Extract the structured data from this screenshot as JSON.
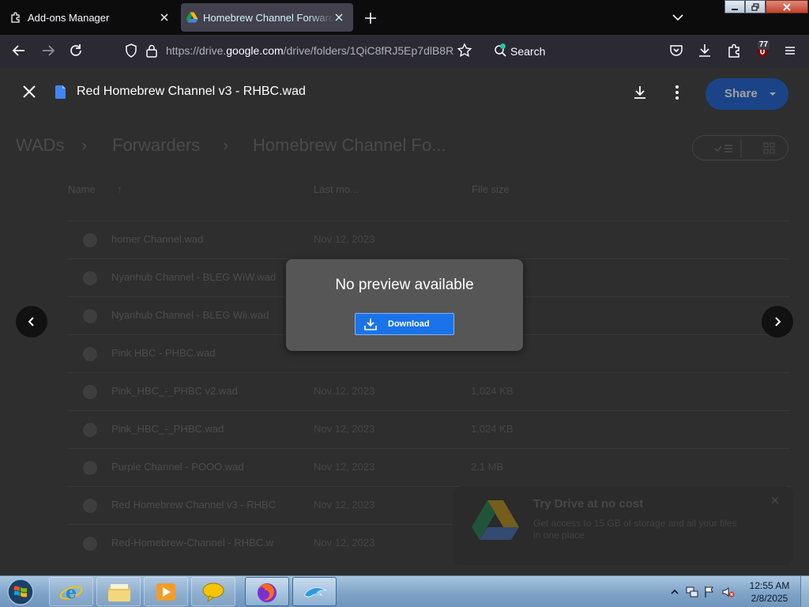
{
  "browser": {
    "tabs": [
      {
        "title": "Add-ons Manager",
        "icon": "puzzle-icon",
        "active": false
      },
      {
        "title": "Homebrew Channel Forwarders",
        "icon": "google-drive-icon",
        "active": true
      }
    ],
    "url": {
      "prefix": "https://drive.",
      "domain": "google.com",
      "rest": "/drive/folders/1QiC8fRJ5Ep7dlB8R"
    },
    "search_label": "Search",
    "extension_badge": "77",
    "accent": "#0b57d0"
  },
  "drive": {
    "breadcrumbs": [
      "WADs",
      "Forwarders",
      "Homebrew Channel Fo..."
    ],
    "columns": [
      "Name",
      "Last mo...",
      "File size"
    ],
    "files": [
      {
        "name": "homer Channel.wad",
        "modified": "Nov 12, 2023",
        "size": ""
      },
      {
        "name": "Nyanhub Channel - BLEG WiW.wad",
        "modified": "",
        "size": ""
      },
      {
        "name": "Nyanhub Channel - BLEG Wii.wad",
        "modified": "",
        "size": ""
      },
      {
        "name": "Pink HBC - PHBC.wad",
        "modified": "",
        "size": ""
      },
      {
        "name": "Pink_HBC_-_PHBC v2.wad",
        "modified": "Nov 12, 2023",
        "size": "1,024 KB"
      },
      {
        "name": "Pink_HBC_-_PHBC.wad",
        "modified": "Nov 12, 2023",
        "size": "1,024 KB"
      },
      {
        "name": "Purple Channel - POOO.wad",
        "modified": "Nov 12, 2023",
        "size": "2.1 MB"
      },
      {
        "name": "Red Homebrew Channel v3 - RHBC",
        "modified": "Nov 12, 2023",
        "size": ""
      },
      {
        "name": "Red-Homebrew-Channel - RHBC.w",
        "modified": "Nov 12, 2023",
        "size": ""
      }
    ],
    "promo": {
      "title": "Try Drive at no cost",
      "body": "Get access to 15 GB of storage and all your files in one place"
    }
  },
  "viewer": {
    "file_title": "Red Homebrew Channel v3 - RHBC.wad",
    "share_label": "Share",
    "no_preview_text": "No preview available",
    "download_label": "Download"
  },
  "taskbar": {
    "apps": [
      "internet-explorer-icon",
      "file-explorer-icon",
      "media-player-icon",
      "chat-icon",
      "firefox-icon",
      "dolphin-emulator-icon"
    ],
    "time": "12:55 AM",
    "date": "2/8/2025"
  }
}
